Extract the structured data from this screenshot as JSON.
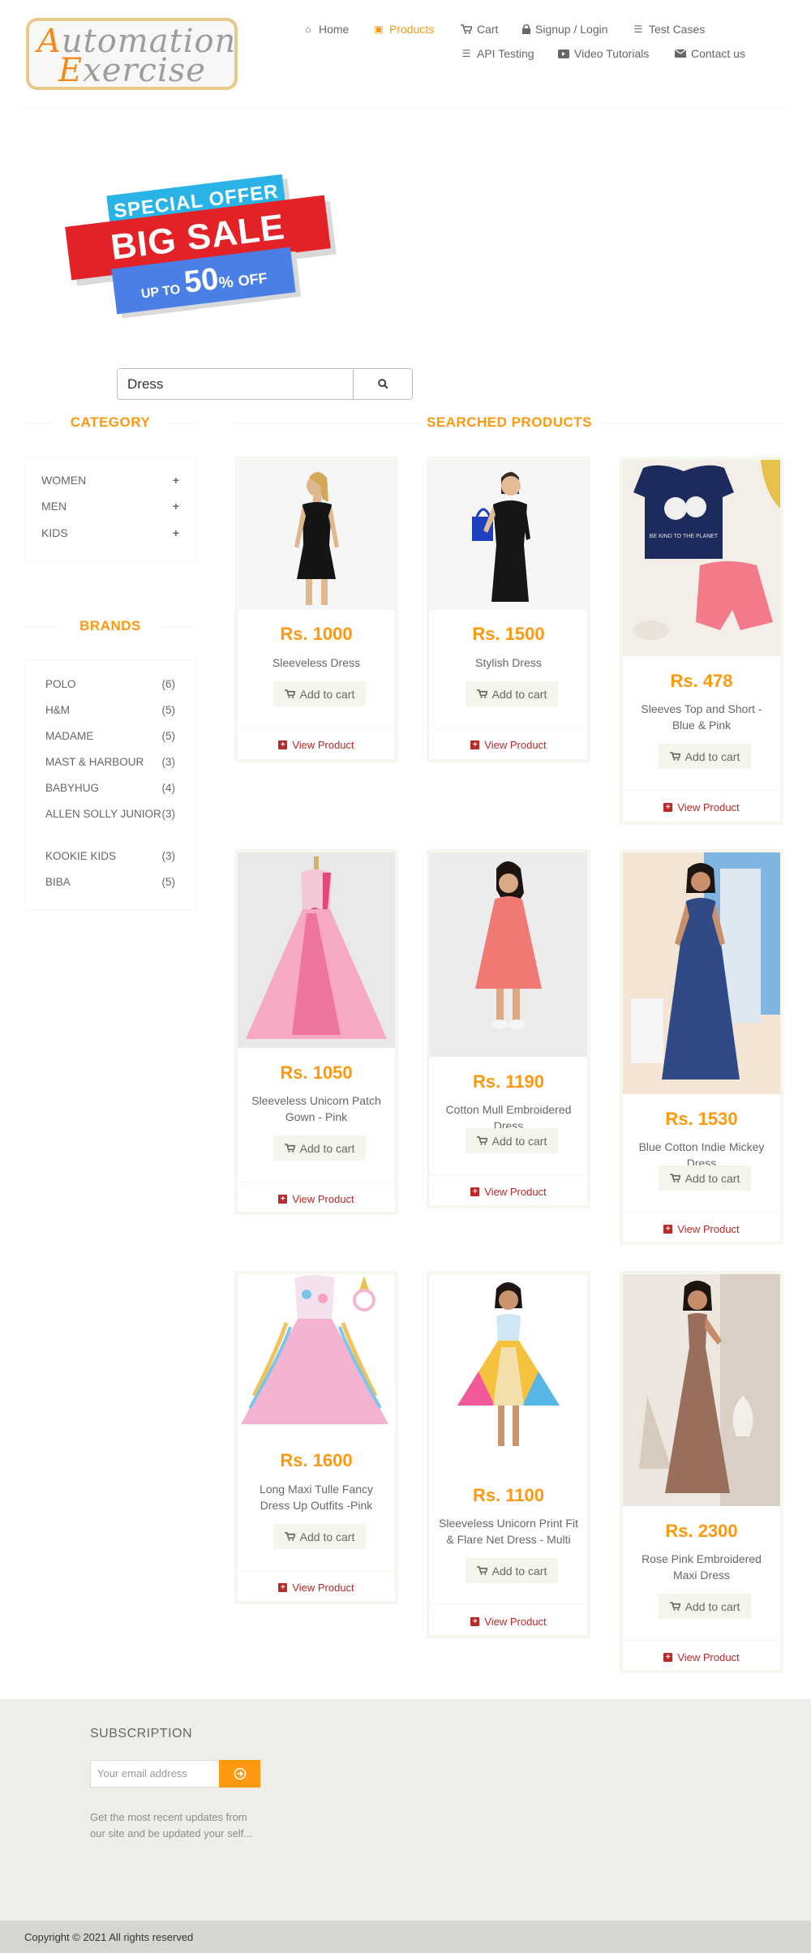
{
  "header": {
    "logo": {
      "line1_cap": "A",
      "line1_rest": "utomation",
      "line2_cap": "E",
      "line2_rest": "xercise"
    },
    "nav": [
      {
        "label": "Home",
        "icon": "home-icon"
      },
      {
        "label": "Products",
        "icon": "products-icon",
        "active": true
      },
      {
        "label": "Cart",
        "icon": "cart-icon"
      },
      {
        "label": "Signup / Login",
        "icon": "lock-icon"
      },
      {
        "label": "Test Cases",
        "icon": "list-icon"
      },
      {
        "label": "API Testing",
        "icon": "list-icon"
      },
      {
        "label": "Video Tutorials",
        "icon": "youtube-icon"
      },
      {
        "label": "Contact us",
        "icon": "envelope-icon"
      }
    ]
  },
  "banner": {
    "special": "SPECIAL OFFER",
    "big": "BIG SALE",
    "up_to": "UP TO",
    "percent": "50",
    "pct_sign": "%",
    "off": "OFF"
  },
  "search": {
    "value": "Dress"
  },
  "sidebar": {
    "category_title": "CATEGORY",
    "categories": [
      "Women",
      "Men",
      "Kids"
    ],
    "brands_title": "BRANDS",
    "brands": [
      {
        "name": "Polo",
        "count": "(6)"
      },
      {
        "name": "H&M",
        "count": "(5)"
      },
      {
        "name": "Madame",
        "count": "(5)"
      },
      {
        "name": "Mast & Harbour",
        "count": "(3)"
      },
      {
        "name": "Babyhug",
        "count": "(4)"
      },
      {
        "name": "Allen Solly Junior",
        "count": "(3)"
      },
      {
        "name": "Kookie Kids",
        "count": "(3)"
      },
      {
        "name": "Biba",
        "count": "(5)"
      }
    ]
  },
  "main": {
    "title": "SEARCHED PRODUCTS",
    "add_to_cart": "Add to cart",
    "view_product": "View Product",
    "products": [
      {
        "price": "Rs. 1000",
        "name": "Sleeveless Dress"
      },
      {
        "price": "Rs. 1500",
        "name": "Stylish Dress"
      },
      {
        "price": "Rs. 478",
        "name": "Sleeves Top and Short - Blue & Pink"
      },
      {
        "price": "Rs. 1050",
        "name": "Sleeveless Unicorn Patch Gown - Pink"
      },
      {
        "price": "Rs. 1190",
        "name": "Cotton Mull Embroidered Dress"
      },
      {
        "price": "Rs. 1530",
        "name": "Blue Cotton Indie Mickey Dress"
      },
      {
        "price": "Rs. 1600",
        "name": "Long Maxi Tulle Fancy Dress Up Outfits -Pink"
      },
      {
        "price": "Rs. 1100",
        "name": "Sleeveless Unicorn Print Fit & Flare Net Dress - Multi"
      },
      {
        "price": "Rs. 2300",
        "name": "Rose Pink Embroidered Maxi Dress"
      }
    ]
  },
  "footer": {
    "subscription_title": "SUBSCRIPTION",
    "email_placeholder": "Your email address",
    "subscription_text": "Get the most recent updates from our site and be updated your self...",
    "copyright": "Copyright © 2021 All rights reserved"
  },
  "colors": {
    "accent": "#fe980f",
    "view_product": "#b92a2a",
    "footer_bg": "#eeede8"
  }
}
